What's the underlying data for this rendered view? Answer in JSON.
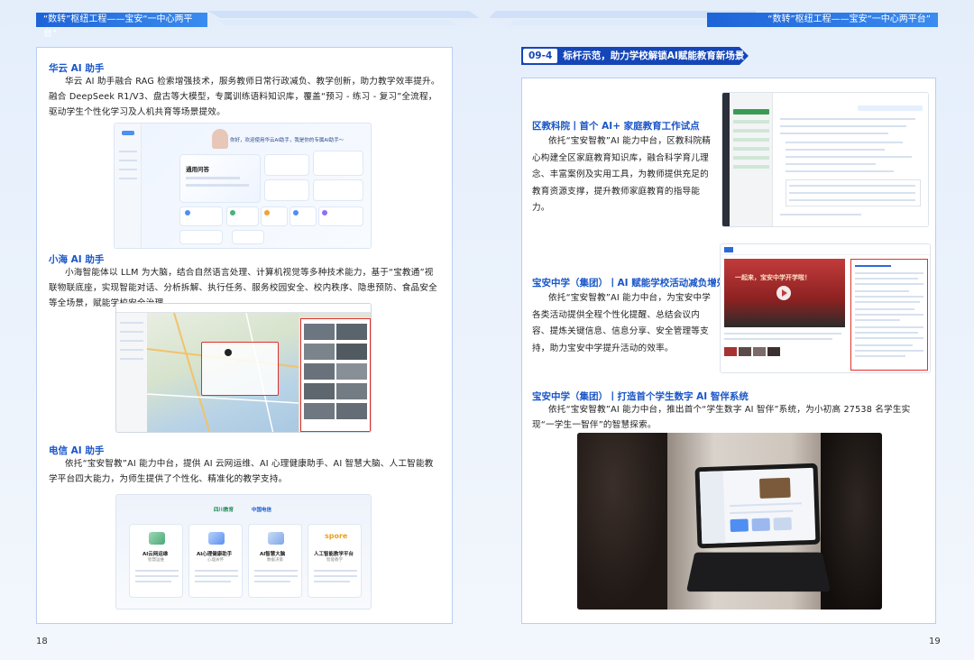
{
  "header": {
    "left_tag": "“数转”枢纽工程——宝安“一中心两平台”",
    "right_tag": "“数转”枢纽工程——宝安“一中心两平台”"
  },
  "left_page": {
    "page_number": "18",
    "sections": [
      {
        "title": "华云 AI 助手",
        "body": "华云 AI 助手融合 RAG 检索增强技术，服务教师日常行政减负、教学创新，助力教学效率提升。融合 DeepSeek R1/V3、盘古等大模型，专属训练语料知识库，覆盖“预习 - 练习 - 复习”全流程，驱动学生个性化学习及人机共育等场景提效。"
      },
      {
        "title": "小海 AI 助手",
        "body": "小海智能体以 LLM 为大脑，结合自然语言处理、计算机视觉等多种技术能力，基于“宝教通”视联物联底座，实现智能对话、分析拆解、执行任务、服务校园安全、校内秩序、隐患预防、食品安全等全场景，赋能学校安全治理。"
      },
      {
        "title": "电信 AI 助手",
        "body": "依托“宝安智教”AI 能力中台，提供 AI 云网运维、AI 心理健康助手、AI 智慧大脑、人工智能教学平台四大能力，为师生提供了个性化、精准化的教学支持。"
      }
    ],
    "huayun_shot": {
      "welcome": "你好，欢迎使用华云AI助手，我是你的专属AI助手～",
      "card_title": "通用问答"
    },
    "telecom_shot": {
      "logo_left": "四川教育",
      "logo_right": "中国电信",
      "cards": [
        "AI云网运维",
        "AI心理健康助手",
        "AI智慧大脑",
        "人工智能教学平台"
      ],
      "card_subs": [
        "智慧运维",
        "心理关怀",
        "数据决策",
        "智能教学"
      ],
      "spore": "spore"
    }
  },
  "right_page": {
    "page_number": "19",
    "tab_number": "09-4",
    "tab_title": "标杆示范，助力学校解锁AI赋能教育新场景",
    "sections": [
      {
        "title": "区教科院丨首个 AI+ 家庭教育工作试点",
        "body": "依托“宝安智教”AI 能力中台，区教科院精心构建全区家庭教育知识库，融合科学育儿理念、丰富案例及实用工具，为教师提供充足的教育资源支撑，提升教师家庭教育的指导能力。"
      },
      {
        "title": "宝安中学（集团）丨AI 赋能学校活动减负增效",
        "body": "依托“宝安智教”AI 能力中台，为宝安中学各类活动提供全程个性化提醒、总结会议内容、提炼关键信息、信息分享、安全管理等支持，助力宝安中学提升活动的效率。"
      },
      {
        "title": "宝安中学（集团）丨打造首个学生数字 AI 智伴系统",
        "body": "依托“宝安智教”AI 能力中台，推出首个“学生数字 AI 智伴”系统，为小初高 27538 名学生实现“一学生一智伴”的智慧探索。"
      }
    ],
    "video_caption": "一起来，宝安中学开学啦！"
  }
}
